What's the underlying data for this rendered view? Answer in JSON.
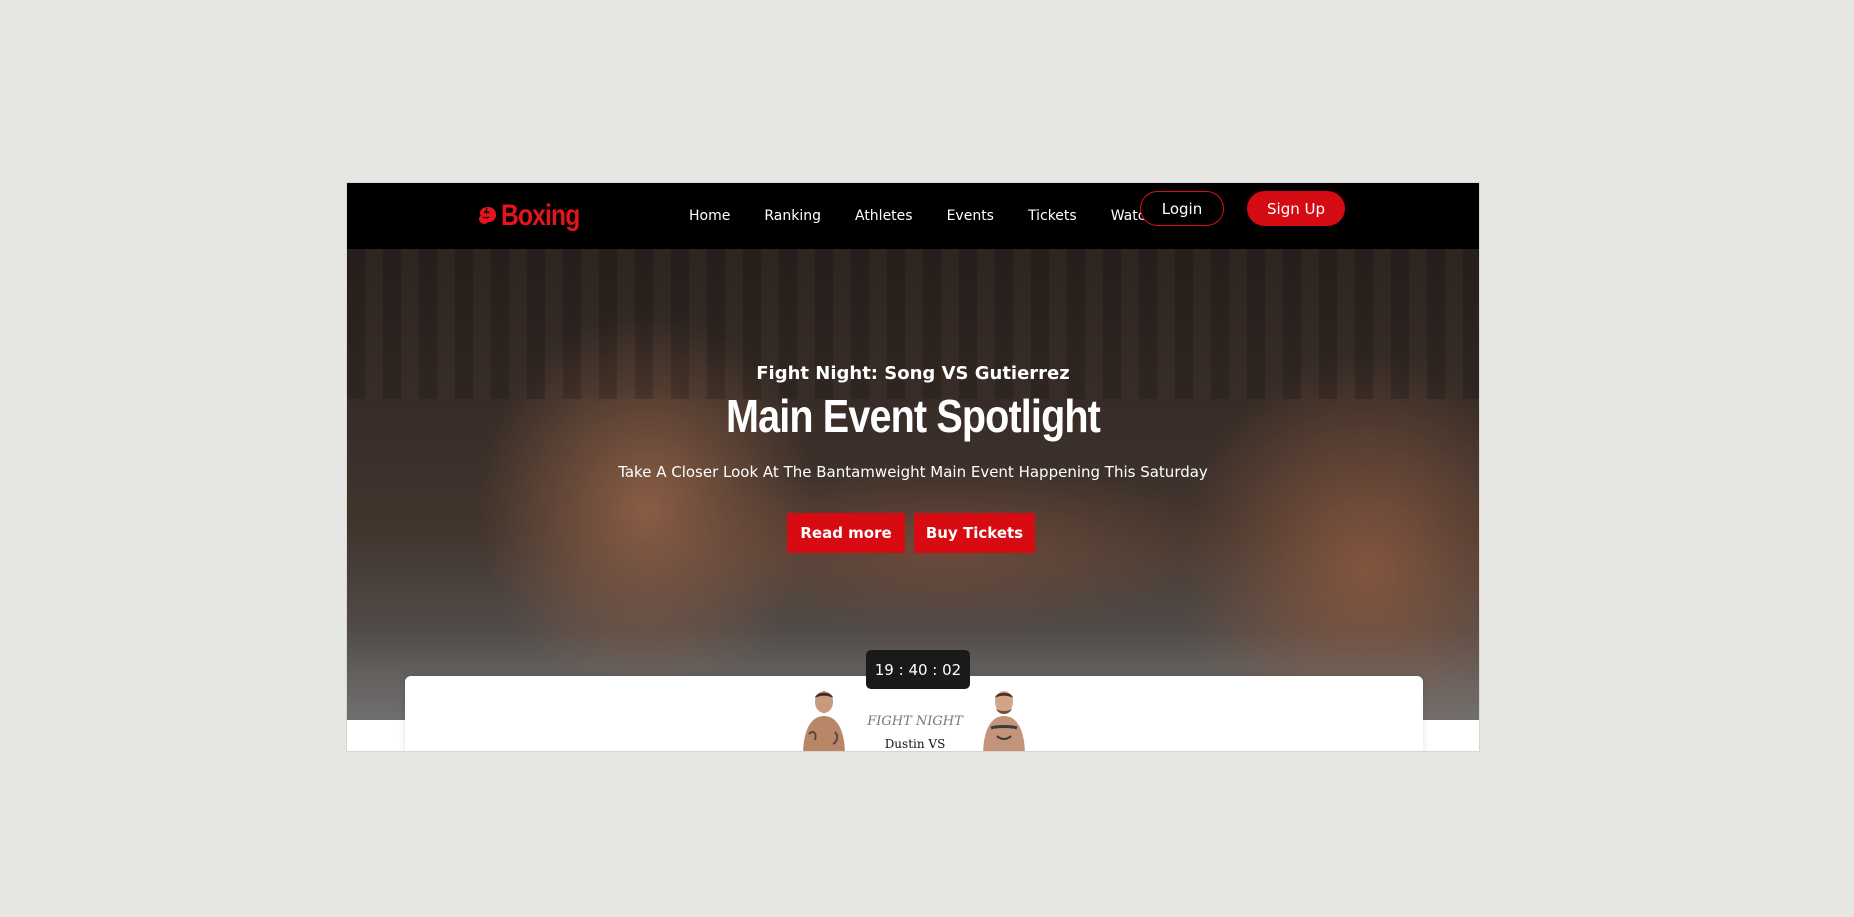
{
  "brand": {
    "name": "Boxing",
    "color": "#e3141b"
  },
  "nav": {
    "links": [
      "Home",
      "Ranking",
      "Athletes",
      "Events",
      "Tickets",
      "Watch"
    ],
    "login_label": "Login",
    "signup_label": "Sign Up"
  },
  "hero": {
    "subtitle": "Fight Night: Song VS Gutierrez",
    "title": "Main Event Spotlight",
    "description": "Take A Closer Look At The Bantamweight Main Event Happening This Saturday",
    "read_more_label": "Read more",
    "buy_tickets_label": "Buy Tickets",
    "accent": "#d80a12"
  },
  "countdown": {
    "text": "19 : 40 : 02"
  },
  "fight_card": {
    "label": "FIGHT NIGHT",
    "names": "Dustin VS"
  }
}
